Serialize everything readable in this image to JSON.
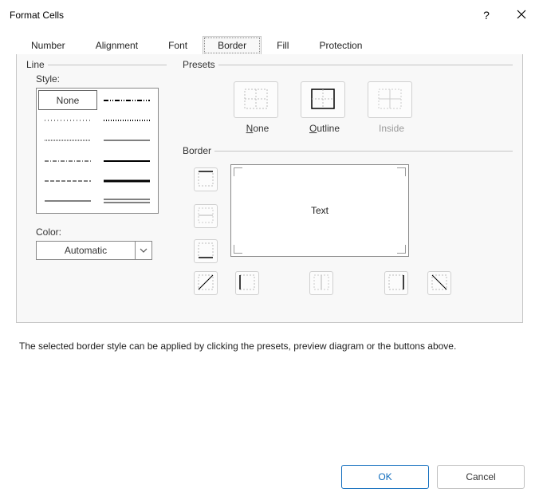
{
  "title": "Format Cells",
  "tabs": [
    "Number",
    "Alignment",
    "Font",
    "Border",
    "Fill",
    "Protection"
  ],
  "active_tab": "Border",
  "groups": {
    "line": "Line",
    "presets": "Presets",
    "border": "Border"
  },
  "line": {
    "style_label": "Style:",
    "none": "None",
    "color_label": "Color:",
    "color_value": "Automatic"
  },
  "presets": {
    "none": "None",
    "outline": "Outline",
    "inside": "Inside"
  },
  "preview_text": "Text",
  "help_text": "The selected border style can be applied by clicking the presets, preview diagram or the buttons above.",
  "buttons": {
    "ok": "OK",
    "cancel": "Cancel"
  }
}
